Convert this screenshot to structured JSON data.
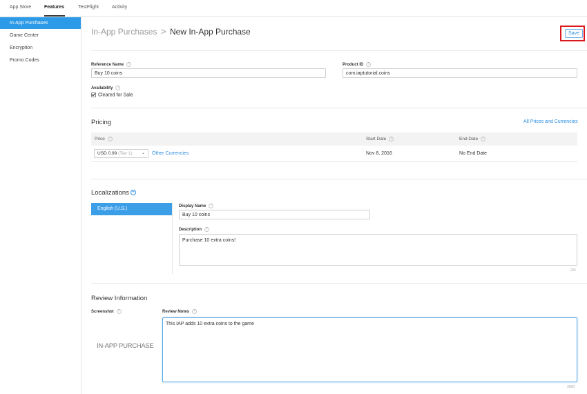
{
  "topnav": {
    "tabs": [
      {
        "label": "App Store"
      },
      {
        "label": "Features"
      },
      {
        "label": "TestFlight"
      },
      {
        "label": "Activity"
      }
    ]
  },
  "sidebar": {
    "items": [
      {
        "label": "In-App Purchases"
      },
      {
        "label": "Game Center"
      },
      {
        "label": "Encryption"
      },
      {
        "label": "Promo Codes"
      }
    ]
  },
  "header": {
    "breadcrumb_parent": "In-App Purchases",
    "separator": ">",
    "title": "New In-App Purchase",
    "save_label": "Save"
  },
  "details": {
    "reference_name_label": "Reference Name",
    "reference_name_value": "Buy 10 coins",
    "product_id_label": "Product ID",
    "product_id_value": "com.iaptutorial.coins",
    "availability_label": "Availability",
    "cleared_for_sale_label": "Cleared for Sale"
  },
  "pricing": {
    "title": "Pricing",
    "all_prices_link": "All Prices and Currencies",
    "columns": {
      "price": "Price",
      "start_date": "Start Date",
      "end_date": "End Date"
    },
    "price_value": "USD 0.99",
    "price_tier": "(Tier 1)",
    "other_currencies_link": "Other Currencies",
    "start_date_value": "Nov 8, 2016",
    "end_date_value": "No End Date"
  },
  "localizations": {
    "title": "Localizations",
    "tab_label": "English (U.S.)",
    "display_name_label": "Display Name",
    "display_name_value": "Buy 10 coins",
    "description_label": "Description",
    "description_value": "Purchase 10 extra coins!",
    "description_counter": "231"
  },
  "review": {
    "title": "Review Information",
    "screenshot_label": "Screenshot",
    "screenshot_image_text": "IN-APP PURCHASE",
    "notes_label": "Review Notes",
    "notes_value": "This IAP adds 10 extra coins to the game",
    "notes_counter": "3960"
  },
  "colors": {
    "accent": "#2c9ae6",
    "highlight_frame": "#d9181e"
  }
}
